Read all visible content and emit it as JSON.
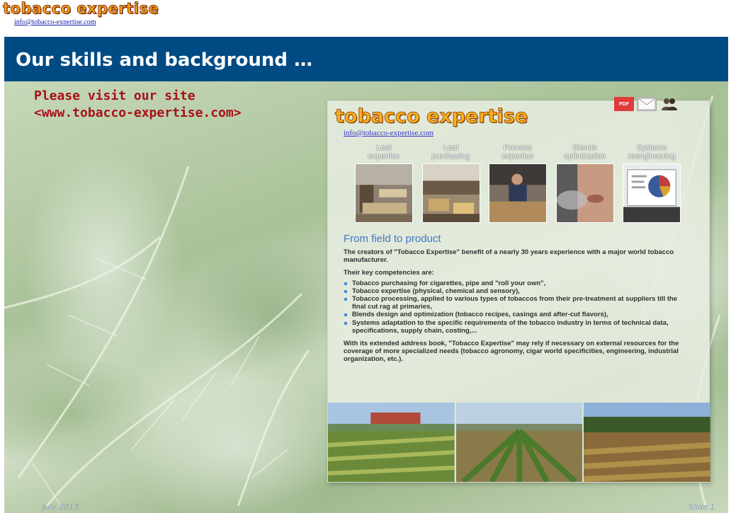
{
  "header": {
    "logo": "tobacco expertise",
    "email": "info@tobacco-expertise.com"
  },
  "slide": {
    "title": "Our skills and background …",
    "visit_line1": "Please visit our site",
    "visit_line2": "<www.tobacco-expertise.com>"
  },
  "site": {
    "logo": "tobacco expertise",
    "email": "info@tobacco-expertise.com",
    "icons": [
      "pdf-icon",
      "mail-icon",
      "users-icon"
    ],
    "pdf_badge": "PDF",
    "nav": [
      {
        "line1": "Leaf",
        "line2": "expertise"
      },
      {
        "line1": "Leaf",
        "line2": "purchasing"
      },
      {
        "line1": "Process",
        "line2": "expertise"
      },
      {
        "line1": "Blends",
        "line2": "optimization"
      },
      {
        "line1": "Systems",
        "line2": "reengineering"
      }
    ],
    "heading": "From field to product",
    "intro": "The creators of \"Tobacco Expertise\" benefit of a nearly 30 years experience with a major world tobacco manufacturer.",
    "competencies_label": "Their key competencies are:",
    "competencies": [
      "Tobacco purchasing for cigarettes, pipe and \"roll your own\",",
      "Tobacco expertise (physical, chemical and sensory),",
      "Tobacco processing, applied to various types of tobaccos from their pre-treatment at suppliers till the final cut rag at primaries,",
      "Blends design and optimization (tobacco recipes, casings and after-cut flavors),",
      "Systems adaptation to the specific requirements of the tobacco industry in terms of technical data, specifications, supply chain, costing,..."
    ],
    "closing": "With its extended address book, \"Tobacco Expertise\" may rely if necessary on external resources for the coverage of more specialized needs (tobacco agronomy, cigar world specificities, engineering, industrial organization, etc.)."
  },
  "footer": {
    "date": "July 2013",
    "slide_number": "Slide 1"
  },
  "colors": {
    "slide_bg": "#004b84",
    "title_text": "#ffffff",
    "visit_text": "#a8101a",
    "logo_orange": "#f7a21a",
    "site_heading": "#3e78cc"
  }
}
